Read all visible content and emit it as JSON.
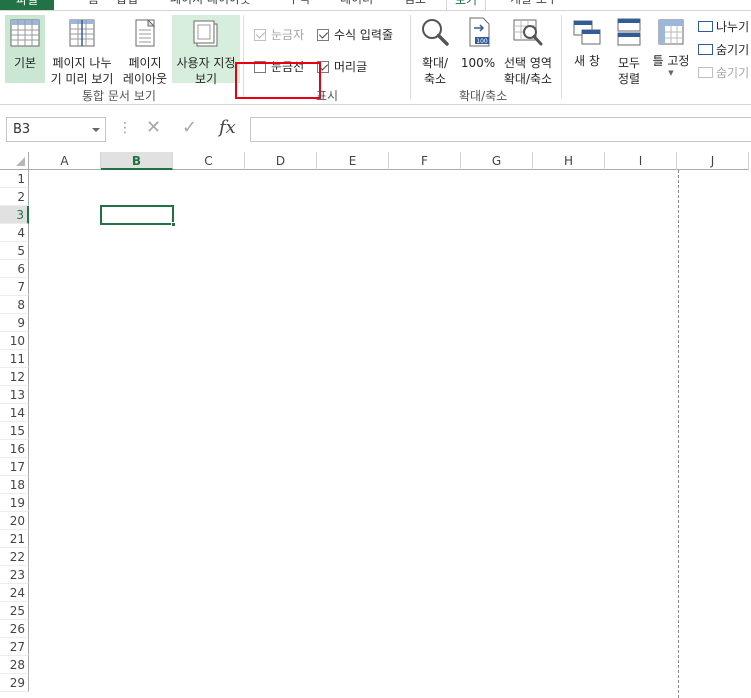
{
  "tabs": [
    {
      "label": "파일",
      "active": false
    },
    {
      "label": "홈",
      "active": false
    },
    {
      "label": "삽입",
      "active": false
    },
    {
      "label": "페이지 레이아웃",
      "active": false
    },
    {
      "label": "수식",
      "active": false
    },
    {
      "label": "데이터",
      "active": false
    },
    {
      "label": "검토",
      "active": false
    },
    {
      "label": "보기",
      "active": true
    },
    {
      "label": "개발 도구",
      "active": false
    }
  ],
  "ribbon": {
    "workbook_views": {
      "group_label": "통합 문서 보기",
      "normal": "기본",
      "page_break_preview": "페이지 나누\n기 미리 보기",
      "page_layout": "페이지\n레이아웃",
      "custom_views": "사용자 지정\n보기"
    },
    "show": {
      "group_label": "표시",
      "ruler": "눈금자",
      "formula_bar": "수식 입력줄",
      "gridlines": "눈금선",
      "headings": "머리글",
      "ruler_checked": true,
      "formula_bar_checked": true,
      "gridlines_checked": false,
      "headings_checked": true
    },
    "zoom": {
      "group_label": "확대/축소",
      "zoom": "확대/\n축소",
      "hundred": "100%",
      "zoom_to_selection": "선택 영역\n확대/축소"
    },
    "window": {
      "new_window": "새 창",
      "arrange_all": "모두\n정렬",
      "freeze_panes": "틀 고정",
      "split": "나누기",
      "hide": "숨기기",
      "unhide": "숨기기 취소"
    }
  },
  "formula_bar": {
    "name_box": "B3",
    "fx": "fx",
    "value": ""
  },
  "grid": {
    "columns": [
      "A",
      "B",
      "C",
      "D",
      "E",
      "F",
      "G",
      "H",
      "I",
      "J"
    ],
    "active_column": "B",
    "rows": [
      "1",
      "2",
      "3",
      "4",
      "5",
      "6",
      "7",
      "8",
      "9",
      "10",
      "11",
      "12",
      "13",
      "14",
      "15",
      "16",
      "17",
      "18",
      "19",
      "20",
      "21",
      "22",
      "23",
      "24",
      "25",
      "26",
      "27",
      "28",
      "29"
    ],
    "active_row": "3",
    "active_cell": "B3"
  },
  "colors": {
    "accent": "#217346",
    "highlight_box": "#e60012"
  }
}
